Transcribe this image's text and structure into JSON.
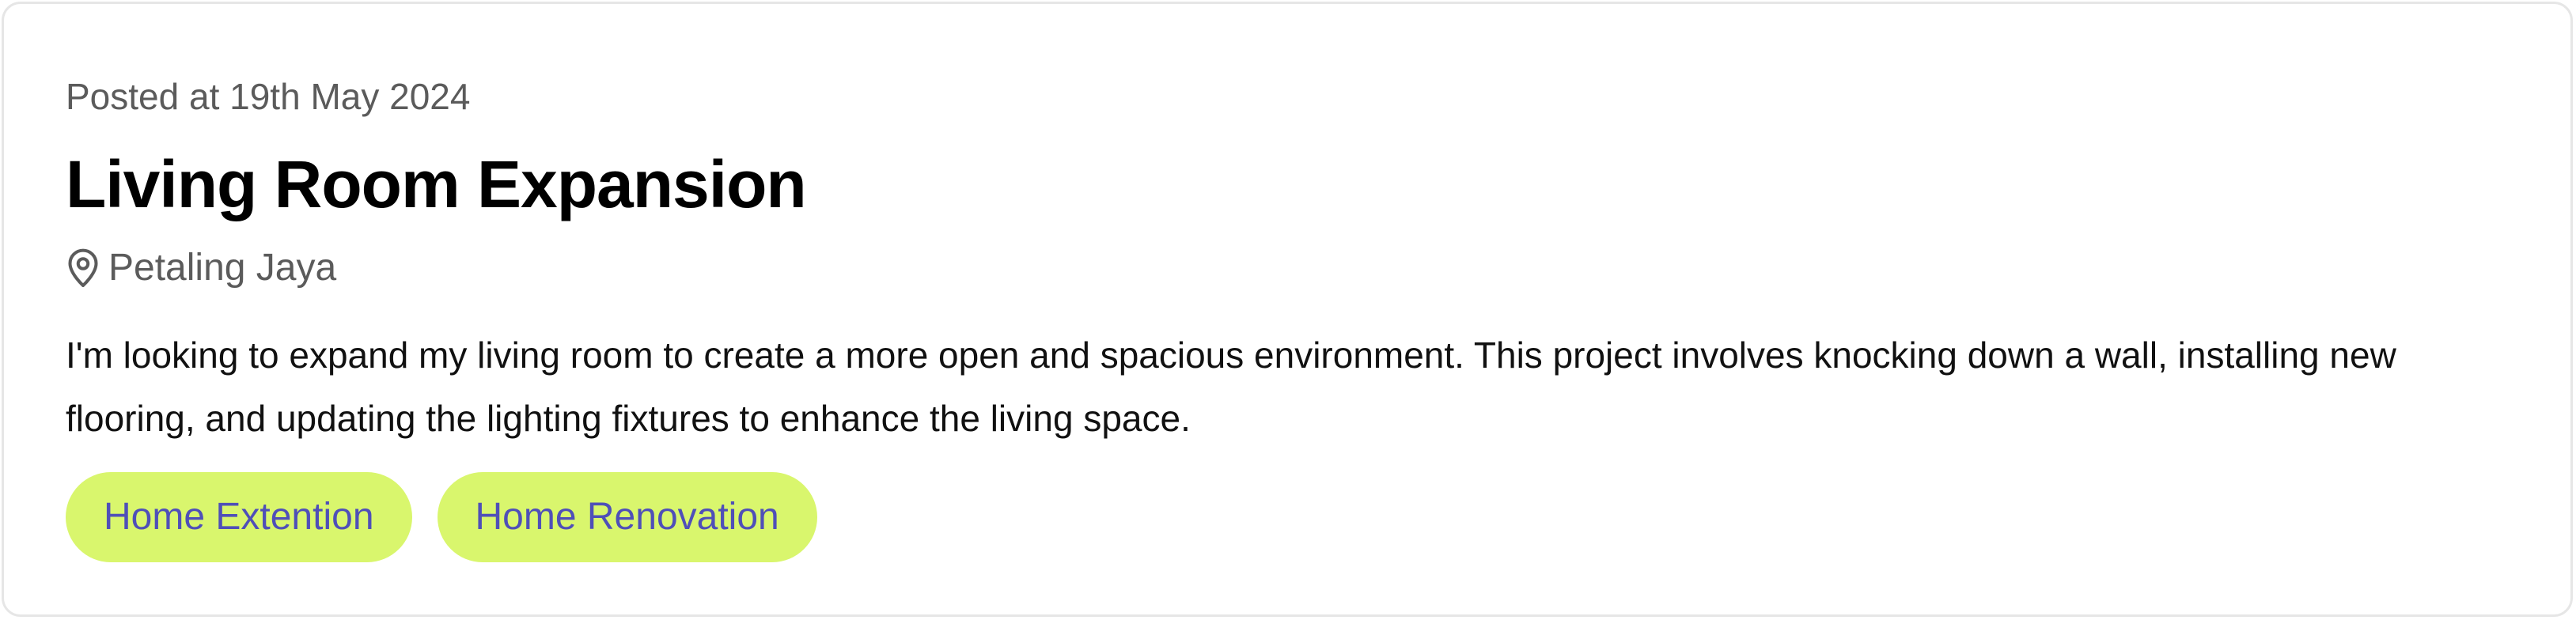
{
  "post": {
    "posted_at": "Posted at 19th May 2024",
    "title": "Living Room Expansion",
    "location": {
      "icon": "map-pin-icon",
      "text": "Petaling Jaya"
    },
    "description": "I'm looking to expand my living room to create a more open and spacious environment. This project involves knocking down a wall, installing new flooring, and updating the lighting fixtures to enhance the living space.",
    "tags": [
      {
        "label": "Home Extention"
      },
      {
        "label": "Home Renovation"
      }
    ]
  },
  "colors": {
    "tag_background": "#d9f66d",
    "tag_text": "#4f4fb8",
    "muted_text": "#5b5b5b",
    "card_border": "#e6e6e6"
  }
}
